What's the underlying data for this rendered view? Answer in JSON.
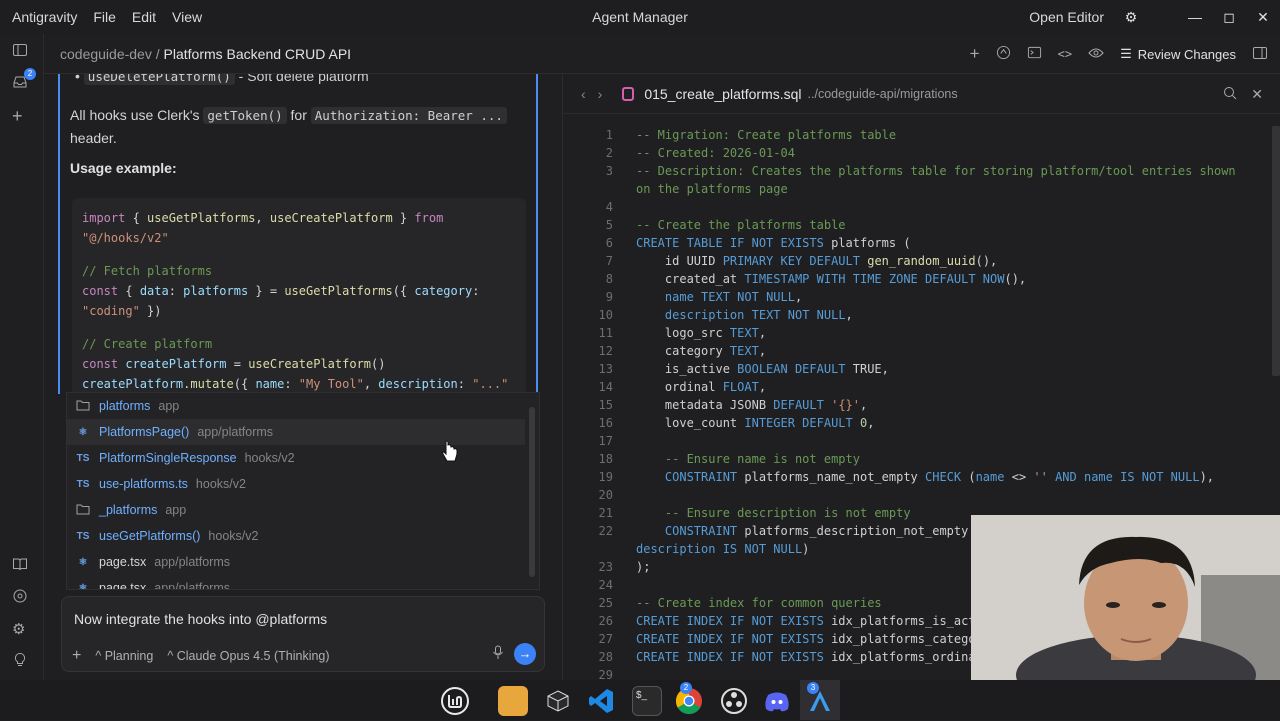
{
  "titlebar": {
    "app_name": "Antigravity",
    "menu": [
      "File",
      "Edit",
      "View"
    ],
    "center_title": "Agent Manager",
    "open_editor": "Open Editor"
  },
  "rail": {
    "inbox_badge": "2"
  },
  "breadcrumb": {
    "workspace": "codeguide-dev",
    "separator": "/",
    "conversation": "Platforms Backend CRUD API"
  },
  "topbar": {
    "review_changes": "Review Changes"
  },
  "chat": {
    "bullet_code": "useDeletePlatform()",
    "bullet_text": " - Soft delete platform",
    "para_pre": "All hooks use Clerk's ",
    "para_code1": "getToken()",
    "para_mid": " for ",
    "para_code2": "Authorization: Bearer ...",
    "para_post": " header.",
    "usage_heading": "Usage example:"
  },
  "autocomplete": {
    "items": [
      {
        "icon": "folder",
        "name": "platforms",
        "path": "app"
      },
      {
        "icon": "react",
        "name": "PlatformsPage()",
        "path": "app/platforms"
      },
      {
        "icon": "TS",
        "name": "PlatformSingleResponse",
        "path": "hooks/v2"
      },
      {
        "icon": "TS",
        "name": "use-platforms.ts",
        "path": "hooks/v2"
      },
      {
        "icon": "folder",
        "name": "_platforms",
        "path": "app"
      },
      {
        "icon": "TS",
        "name": "useGetPlatforms()",
        "path": "hooks/v2"
      },
      {
        "icon": "react",
        "name": "page.tsx",
        "path": "app/platforms"
      },
      {
        "icon": "react",
        "name": "page.tsx",
        "path": "app/platforms"
      }
    ]
  },
  "input": {
    "text": "Now integrate the hooks into @platforms",
    "mode": "Planning",
    "model": "Claude Opus 4.5 (Thinking)"
  },
  "editor": {
    "filename": "015_create_platforms.sql",
    "path": "../codeguide-api/migrations",
    "line_numbers": [
      "1",
      "2",
      "3",
      "",
      "4",
      "5",
      "6",
      "7",
      "8",
      "9",
      "10",
      "11",
      "12",
      "13",
      "14",
      "15",
      "16",
      "17",
      "18",
      "19",
      "20",
      "21",
      "22",
      "",
      "23",
      "24",
      "25",
      "26",
      "27",
      "28",
      "29"
    ]
  },
  "taskbar": {
    "vscode_badge": "3",
    "chrome_badge": "2"
  }
}
